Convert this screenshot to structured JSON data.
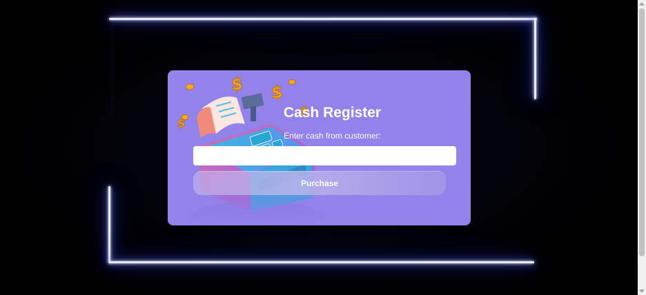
{
  "app": {
    "title": "Cash Register",
    "prompt": "Enter cash from customer:"
  },
  "cash_input": {
    "value": "",
    "placeholder": ""
  },
  "actions": {
    "purchase_label": "Purchase"
  },
  "colors": {
    "card_background": "#9382ea",
    "page_background": "#000000",
    "neon_frame": "#3b4dff"
  },
  "icons": {
    "illustration": "cash-register-illustration"
  }
}
